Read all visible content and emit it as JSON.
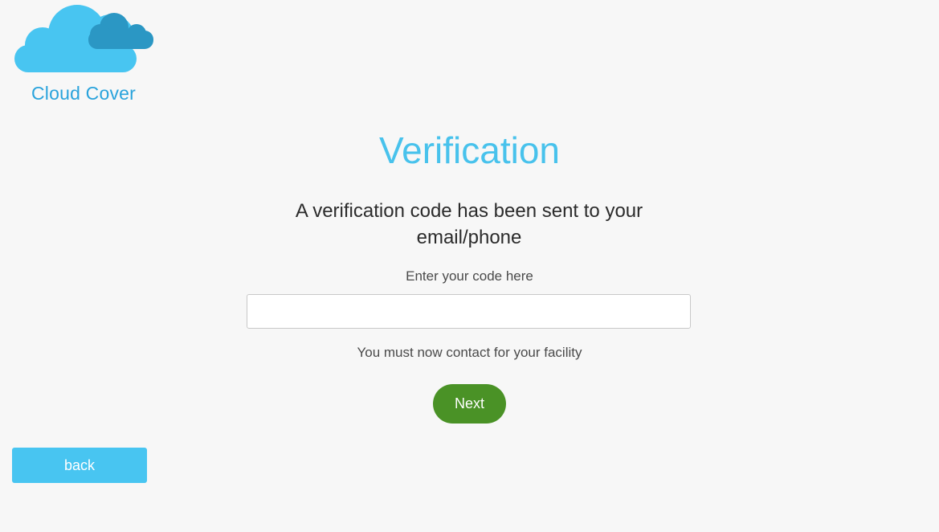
{
  "brand": {
    "name": "Cloud Cover",
    "logo_icon": "cloud-logo-icon",
    "colors": {
      "cloud_front": "#48c5f1",
      "cloud_back": "#2b97c4",
      "text": "#29a3dc"
    }
  },
  "page": {
    "title": "Verification",
    "subtitle": "A verification code has been sent to your email/phone",
    "code_label": "Enter your code here",
    "code_input": {
      "value": "",
      "placeholder": ""
    },
    "notice": "You must now contact for your facility"
  },
  "actions": {
    "next_label": "Next",
    "back_label": "back"
  },
  "colors": {
    "background": "#f7f7f7",
    "title": "#48c2ec",
    "next_button": "#4a9226",
    "back_button": "#48c5f1"
  }
}
